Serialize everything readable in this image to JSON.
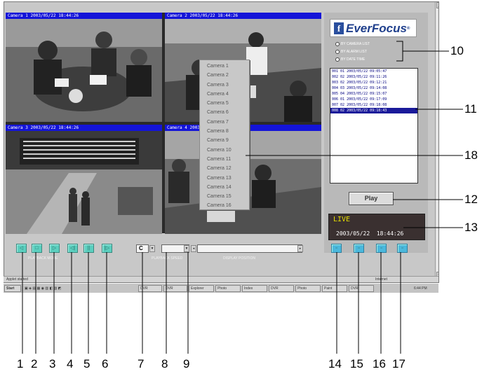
{
  "cameras": [
    {
      "caption": "Camera 1 2003/05/22 18:44:26"
    },
    {
      "caption": "Camera 2 2003/05/22 18:44:26"
    },
    {
      "caption": "Camera 3 2003/05/22 18:44:26"
    },
    {
      "caption": "Camera 4 2003/05/22 18:44:26"
    }
  ],
  "camera_menu": [
    "Camera 1",
    "Camera 2",
    "Camera 3",
    "Camera 4",
    "Camera 5",
    "Camera 6",
    "Camera 7",
    "Camera 8",
    "Camera 9",
    "Camera 10",
    "Camera 11",
    "Camera 12",
    "Camera 13",
    "Camera 14",
    "Camera 15",
    "Camera 16"
  ],
  "logo": {
    "mark": "f",
    "name": "EverFocus",
    "reg": "®",
    "brand_color": "#1f3f8c"
  },
  "radios": [
    {
      "label": "BY CAMERA LIST"
    },
    {
      "label": "BY ALARM LIST"
    },
    {
      "label": "BY DATE TIME"
    }
  ],
  "event_list": {
    "rows": [
      "001 01 2003/05/22 09:05:47",
      "002 02 2003/05/22 09:11:26",
      "003 02 2003/05/22 09:12:21",
      "004 03 2003/05/22 09:14:08",
      "005 04 2003/05/22 09:15:07",
      "006 01 2003/05/22 09:17:09",
      "007 02 2003/05/22 09:18:08",
      "008 02 2003/05/22 09:18:43"
    ],
    "selected_index": 7
  },
  "play_label": "Play",
  "live": {
    "label": "LIVE",
    "date": "2003/05/22",
    "time": "18:44:26",
    "text_color": "#e8e000"
  },
  "toolbar": {
    "playback_label": "PLAYBACK MODE",
    "playback_buttons": [
      {
        "icon": "rewind-icon",
        "glyph": "◁"
      },
      {
        "icon": "stop-icon",
        "glyph": "□"
      },
      {
        "icon": "play-icon",
        "glyph": "▷"
      },
      {
        "icon": "step-back-icon",
        "glyph": "◁|"
      },
      {
        "icon": "pause-icon",
        "glyph": "||"
      },
      {
        "icon": "step-forward-icon",
        "glyph": "|▷"
      }
    ],
    "camera_select_value": "C",
    "speed_label": "PLAYBACK SPEED",
    "display_label": "DISPLAY POSITION",
    "right_buttons": [
      {
        "icon": "full-screen-icon"
      },
      {
        "icon": "quad-view-icon"
      },
      {
        "icon": "nine-view-icon"
      },
      {
        "icon": "sixteen-view-icon"
      }
    ],
    "accent": "#5ccfbf"
  },
  "status_bar": {
    "left": "Applet started",
    "right": "Internet"
  },
  "taskbar": {
    "start": "Start",
    "items": [
      "DVR",
      "DVR",
      "Explorer",
      "Photo",
      "Index",
      "DVR",
      "Photo",
      "Paint",
      "DVR"
    ],
    "clock": "6:44 PM"
  },
  "callouts": [
    "1",
    "2",
    "3",
    "4",
    "5",
    "6",
    "7",
    "8",
    "9",
    "10",
    "11",
    "12",
    "13",
    "14",
    "15",
    "16",
    "17",
    "18"
  ]
}
